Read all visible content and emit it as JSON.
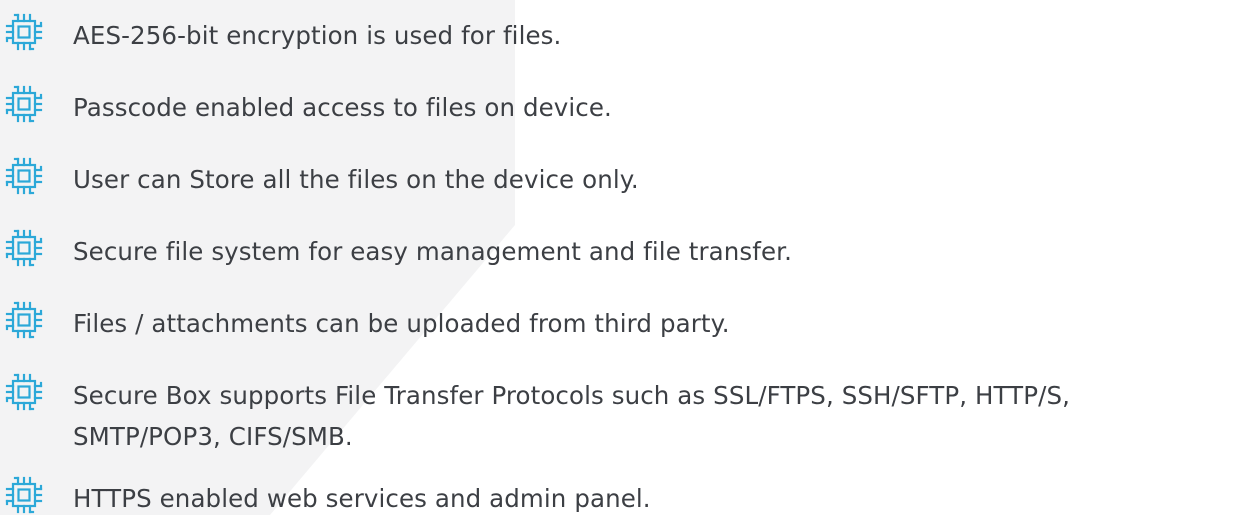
{
  "colors": {
    "icon": "#2ca8d8",
    "text": "#3c3f44",
    "background": "#ffffff",
    "background_shape": "#f3f3f4"
  },
  "features": [
    {
      "icon": "cpu-chip-icon",
      "text": "AES-256-bit encryption is used for files."
    },
    {
      "icon": "cpu-chip-icon",
      "text": "Passcode enabled access to files on device."
    },
    {
      "icon": "cpu-chip-icon",
      "text": "User can Store all the files on the device only."
    },
    {
      "icon": "cpu-chip-icon",
      "text": "Secure file system for easy management and file transfer."
    },
    {
      "icon": "cpu-chip-icon",
      "text": "Files / attachments can be uploaded from third party."
    },
    {
      "icon": "cpu-chip-icon",
      "text": [
        "Secure Box supports File Transfer Protocols such as SSL/FTPS, SSH/SFTP, HTTP/S,",
        "SMTP/POP3, CIFS/SMB."
      ]
    },
    {
      "icon": "cpu-chip-icon",
      "text": "HTTPS enabled web services and admin panel."
    }
  ]
}
